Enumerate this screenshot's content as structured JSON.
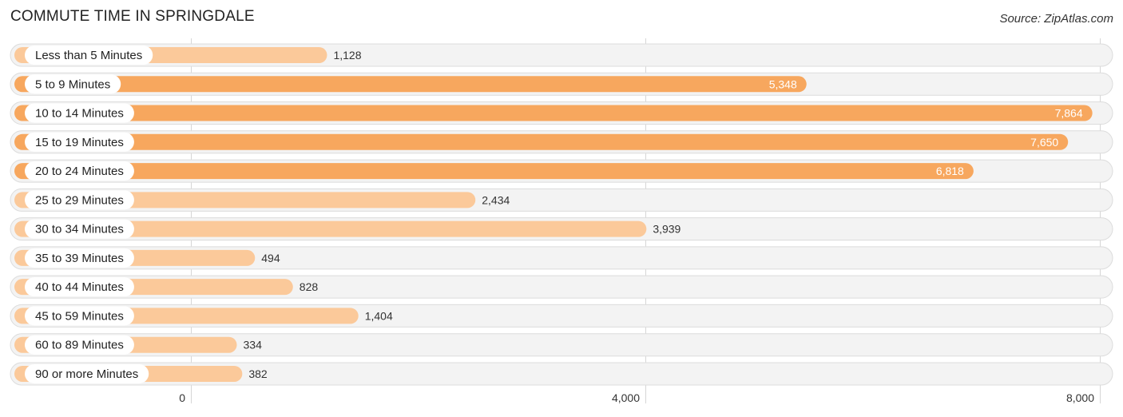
{
  "chart_data": {
    "type": "bar",
    "orientation": "horizontal",
    "title": "COMMUTE TIME IN SPRINGDALE",
    "source": "Source: ZipAtlas.com",
    "categories": [
      "Less than 5 Minutes",
      "5 to 9 Minutes",
      "10 to 14 Minutes",
      "15 to 19 Minutes",
      "20 to 24 Minutes",
      "25 to 29 Minutes",
      "30 to 34 Minutes",
      "35 to 39 Minutes",
      "40 to 44 Minutes",
      "45 to 59 Minutes",
      "60 to 89 Minutes",
      "90 or more Minutes"
    ],
    "values": [
      1128,
      5348,
      7864,
      7650,
      6818,
      2434,
      3939,
      494,
      828,
      1404,
      334,
      382
    ],
    "value_labels": [
      "1,128",
      "5,348",
      "7,864",
      "7,650",
      "6,818",
      "2,434",
      "3,939",
      "494",
      "828",
      "1,404",
      "334",
      "382"
    ],
    "xlim": [
      0,
      8000
    ],
    "xticks": [
      0,
      4000,
      8000
    ],
    "xtick_labels": [
      "0",
      "4,000",
      "8,000"
    ],
    "xlabel": "",
    "ylabel": "",
    "grid": true,
    "legend": "none",
    "colors": {
      "bar_high": "#f7a75e",
      "bar_low": "#fbc99a",
      "track": "#f3f3f3",
      "value_inside": "#ffffff",
      "value_outside": "#333333"
    }
  }
}
